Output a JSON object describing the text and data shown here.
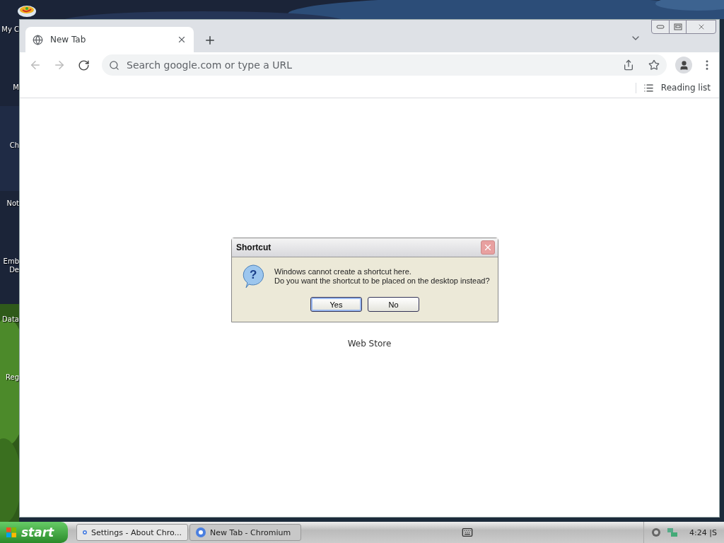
{
  "desktop": {
    "icons": [
      {
        "label": "My C"
      },
      {
        "label": "M"
      },
      {
        "label": "Ch"
      },
      {
        "label": "Not"
      },
      {
        "label": "Emb De"
      },
      {
        "label": "Data"
      },
      {
        "label": "Reg"
      }
    ]
  },
  "browser": {
    "tabs": [
      {
        "title": "New Tab",
        "selected": true
      }
    ],
    "address": {
      "placeholder": "Search google.com or type a URL"
    },
    "reading_list": "Reading list",
    "page_text": "Web Store"
  },
  "dialog": {
    "title": "Shortcut",
    "icon_glyph": "?",
    "message": [
      "Windows cannot create a shortcut here.",
      "Do you want the shortcut to be placed on the desktop instead?"
    ],
    "buttons": [
      {
        "label": "Yes",
        "selected": true
      },
      {
        "label": "No",
        "selected": false
      }
    ]
  },
  "taskbar": {
    "start": "start",
    "tasks": [
      {
        "label": "Settings - About Chro...",
        "selected": false
      },
      {
        "label": "New Tab - Chromium",
        "selected": true
      }
    ],
    "clock": "4:24 |S"
  }
}
